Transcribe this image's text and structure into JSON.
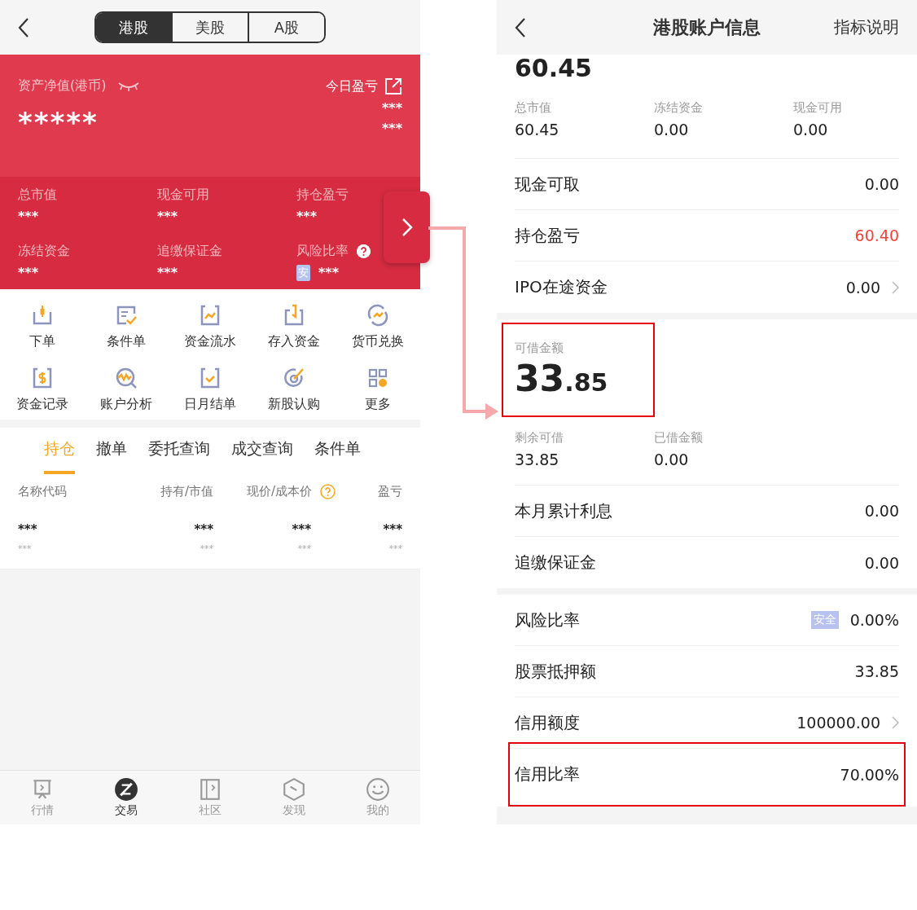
{
  "left": {
    "market_tabs": [
      {
        "label": "港股",
        "selected": true
      },
      {
        "label": "美股",
        "selected": false
      },
      {
        "label": "A股",
        "selected": false
      }
    ],
    "net_assets": {
      "label": "资产净值(港币)",
      "value": "*****",
      "hidden": true
    },
    "today_pl": {
      "label": "今日盈亏",
      "values": [
        "***",
        "***"
      ]
    },
    "stats": [
      {
        "label": "总市值",
        "value": "***"
      },
      {
        "label": "现金可用",
        "value": "***"
      },
      {
        "label": "持仓盈亏",
        "value": "***"
      },
      {
        "label": "冻结资金",
        "value": "***"
      },
      {
        "label": "追缴保证金",
        "value": "***"
      },
      {
        "label": "风险比率",
        "value": "***",
        "badge": "安",
        "help": true
      }
    ],
    "actions": [
      {
        "label": "下单"
      },
      {
        "label": "条件单"
      },
      {
        "label": "资金流水"
      },
      {
        "label": "存入资金"
      },
      {
        "label": "货币兑换"
      },
      {
        "label": "资金记录"
      },
      {
        "label": "账户分析"
      },
      {
        "label": "日月结单"
      },
      {
        "label": "新股认购"
      },
      {
        "label": "更多"
      }
    ],
    "order_tabs": [
      {
        "label": "持仓",
        "selected": true
      },
      {
        "label": "撤单",
        "selected": false
      },
      {
        "label": "委托查询",
        "selected": false
      },
      {
        "label": "成交查询",
        "selected": false
      },
      {
        "label": "条件单",
        "selected": false
      }
    ],
    "table": {
      "columns": [
        {
          "label": "名称代码",
          "help": false
        },
        {
          "label": "持有/市值",
          "help": false
        },
        {
          "label": "现价/成本价",
          "help": true
        },
        {
          "label": "盈亏",
          "help": false
        }
      ],
      "rows": [
        {
          "cells": [
            {
              "main": "***",
              "sub": "***"
            },
            {
              "main": "***",
              "sub": "***"
            },
            {
              "main": "***",
              "sub": "***"
            },
            {
              "main": "***",
              "sub": "***"
            }
          ]
        }
      ]
    },
    "tab_bar": [
      {
        "label": "行情",
        "selected": false
      },
      {
        "label": "交易",
        "selected": true
      },
      {
        "label": "社区",
        "selected": false
      },
      {
        "label": "发现",
        "selected": false
      },
      {
        "label": "我的",
        "selected": false
      }
    ]
  },
  "right": {
    "title": "港股账户信息",
    "help_link": "指标说明",
    "total_clipped": "60.45",
    "summary": [
      {
        "label": "总市值",
        "value": "60.45"
      },
      {
        "label": "冻结资金",
        "value": "0.00"
      },
      {
        "label": "现金可用",
        "value": "0.00"
      }
    ],
    "rows1": [
      {
        "kind": "plain",
        "label": "现金可取",
        "value": "0.00",
        "gain": false,
        "highlighted": false
      },
      {
        "kind": "plain",
        "label": "持仓盈亏",
        "value": "60.40",
        "gain": true,
        "highlighted": false
      },
      {
        "kind": "link",
        "label": "IPO在途资金",
        "value": "0.00",
        "gain": false,
        "highlighted": false
      }
    ],
    "credit": {
      "label": "可借金额",
      "integer": "33",
      "decimal": ".85",
      "highlighted": true
    },
    "credit_stats": [
      {
        "label": "剩余可借",
        "value": "33.85"
      },
      {
        "label": "已借金额",
        "value": "0.00"
      }
    ],
    "rows2": [
      {
        "kind": "plain",
        "label": "本月累计利息",
        "value": "0.00",
        "gain": false,
        "highlighted": false
      },
      {
        "kind": "plain",
        "label": "追缴保证金",
        "value": "0.00",
        "gain": false,
        "highlighted": false
      }
    ],
    "rows3": [
      {
        "kind": "plain",
        "label": "风险比率",
        "badge": "安全",
        "value": "0.00%",
        "gain": false,
        "highlighted": false
      },
      {
        "kind": "plain",
        "label": "股票抵押额",
        "value": "33.85",
        "gain": false,
        "highlighted": false
      },
      {
        "kind": "link",
        "label": "信用额度",
        "value": "100000.00",
        "gain": false,
        "highlighted": false
      },
      {
        "kind": "plain",
        "label": "信用比率",
        "value": "70.00%",
        "gain": false,
        "highlighted": true
      }
    ]
  }
}
